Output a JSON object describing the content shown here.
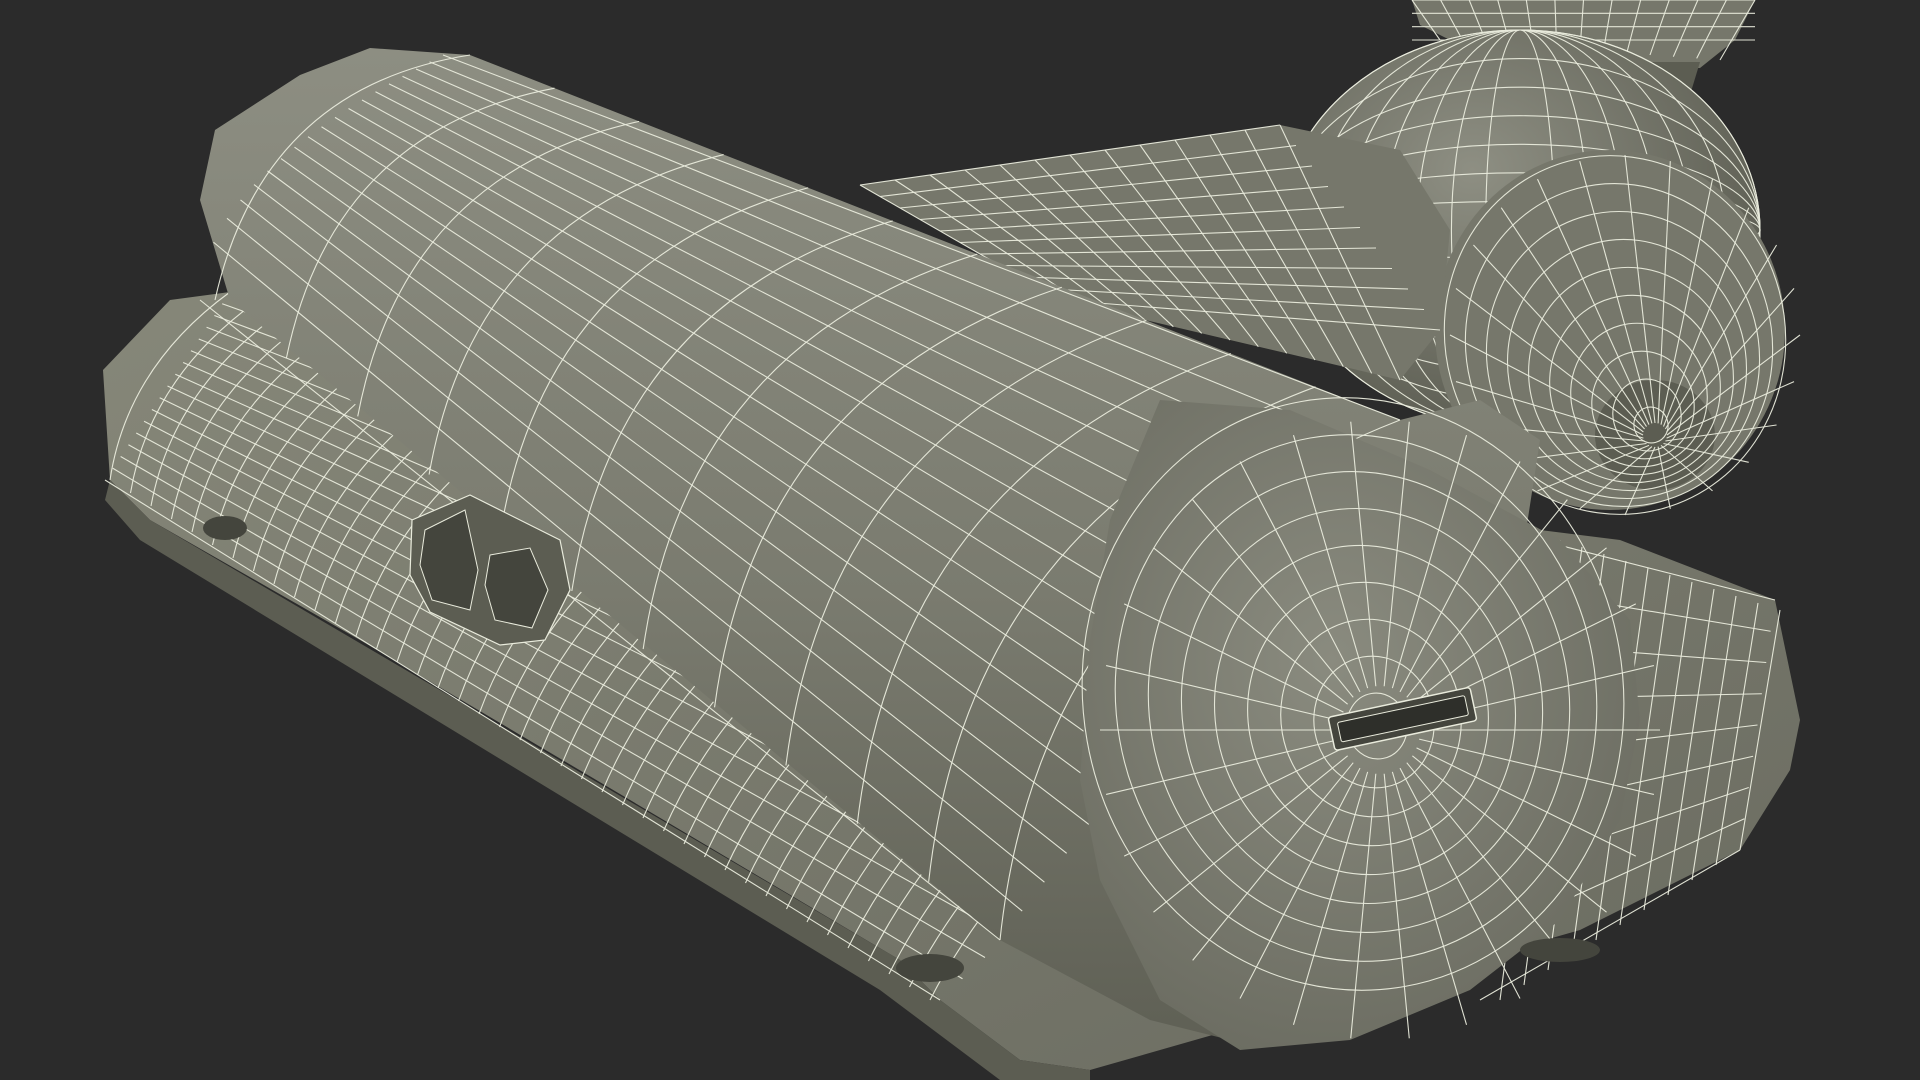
{
  "scene": {
    "subject": "wireframe-3d-model",
    "colors": {
      "background": "#2b2b2b",
      "surface_light": "#8b8c80",
      "surface_mid": "#76776b",
      "surface_dark": "#5c5d52",
      "shadow": "#44453d",
      "wire": "#e9ebdc",
      "slot": "#2e2f2a"
    }
  }
}
